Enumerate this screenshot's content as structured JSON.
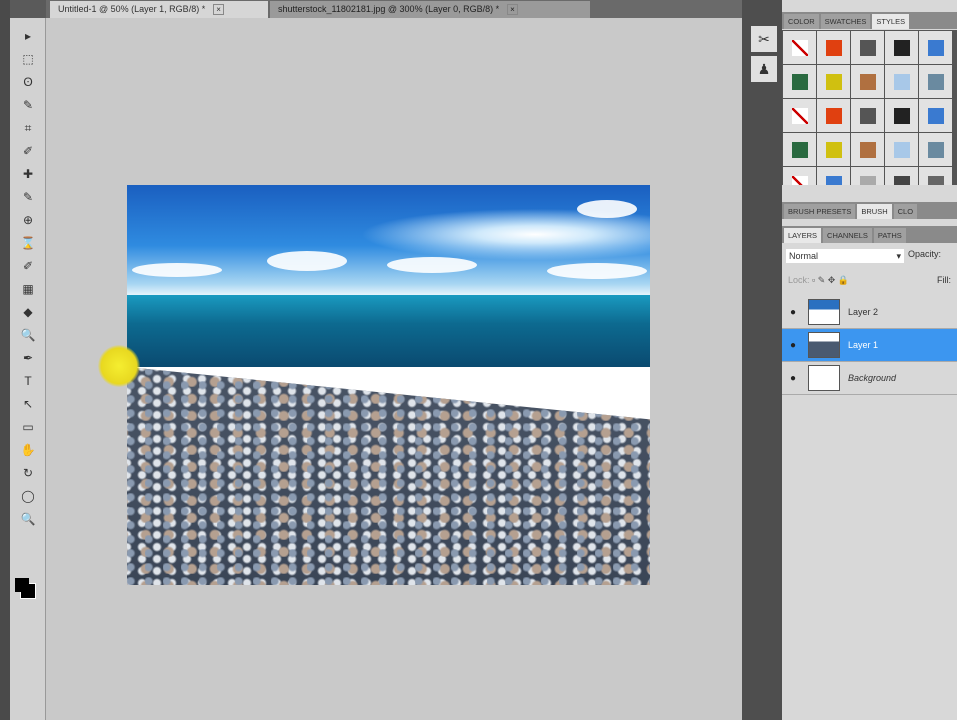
{
  "tabs": [
    {
      "label": "Untitled-1 @ 50% (Layer 1, RGB/8) *",
      "active": true
    },
    {
      "label": "shutterstock_11802181.jpg @ 300% (Layer 0, RGB/8) *",
      "active": false
    }
  ],
  "tab_close": "×",
  "tools": [
    "▸",
    "⬚",
    "ʘ",
    "✎",
    "⌗",
    "✐",
    "✚",
    "✎",
    "⊕",
    "⌛",
    "✐",
    "▦",
    "◆",
    "🔍",
    "✒",
    "T",
    "↖",
    "▭",
    "✋",
    "↻",
    "◯",
    "🔍"
  ],
  "panels": {
    "top_tabs": [
      "Color",
      "Swatches",
      "Styles"
    ],
    "mid_tabs": [
      "Brush Presets",
      "Brush",
      "Clo"
    ],
    "layer_tabs": [
      "Layers",
      "Channels",
      "Paths"
    ],
    "blend_mode": "Normal",
    "opacity_label": "Opacity:",
    "lock_label": "Lock:",
    "fill_label": "Fill:",
    "layers": [
      {
        "name": "Layer 2",
        "selected": false
      },
      {
        "name": "Layer 1",
        "selected": true
      },
      {
        "name": "Background",
        "selected": false
      }
    ]
  },
  "style_colors": [
    "#fff",
    "#e04010",
    "#555",
    "#222",
    "#3a7ad0",
    "#2a6a40",
    "#d0c010",
    "#b07040",
    "#a8c8e8",
    "#6a8aa0",
    "#fff",
    "#e04010",
    "#555",
    "#222",
    "#3a7ad0",
    "#2a6a40",
    "#d0c010",
    "#b07040",
    "#a8c8e8",
    "#6a8aa0",
    "#333",
    "#3a7ad0",
    "#aaa",
    "#444",
    "#666"
  ]
}
